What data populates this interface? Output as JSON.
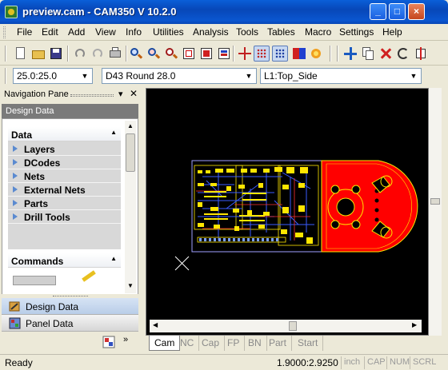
{
  "window": {
    "title": "preview.cam - CAM350 V 10.2.0",
    "controls": [
      "_",
      "□",
      "×"
    ]
  },
  "menu": [
    "File",
    "Edit",
    "Add",
    "View",
    "Info",
    "Utilities",
    "Analysis",
    "Tools",
    "Tables",
    "Macro",
    "Settings",
    "Help"
  ],
  "mdi_controls": [
    "_",
    "□",
    "×"
  ],
  "toolbar": {
    "icons": [
      "new-file-icon",
      "open-folder-icon",
      "save-icon",
      "undo-icon",
      "redo-icon",
      "print-icon",
      "zoom-window-icon",
      "zoom-in-icon",
      "zoom-out-icon",
      "zoom-all-icon",
      "redraw-icon",
      "print-preview-icon",
      "snap-icon",
      "grid-icon",
      "grid-dots-icon",
      "layer-color-icon",
      "highlight-icon",
      "pan-icon",
      "copy-icon",
      "delete-icon",
      "rotate-icon",
      "mirror-icon"
    ]
  },
  "combos": {
    "grid": "25.0:25.0",
    "dcode": "D43  Round 28.0",
    "layer": "L1:Top_Side"
  },
  "nav_pane": {
    "title": "Navigation Pane",
    "section": "Design Data",
    "data_group": {
      "title": "Data",
      "items": [
        "Layers",
        "DCodes",
        "Nets",
        "External Nets",
        "Parts",
        "Drill Tools"
      ]
    },
    "commands_group": {
      "title": "Commands"
    },
    "buttons": [
      "Design Data",
      "Panel Data"
    ]
  },
  "view_tabs": [
    "Cam",
    "NC",
    "Cap",
    "FP",
    "BN",
    "Part",
    "Start"
  ],
  "active_tab": "Cam",
  "status": {
    "ready": "Ready",
    "coords": "1.9000:2.9250",
    "indicators": [
      "inch",
      "CAP",
      "NUM",
      "SCRL"
    ]
  },
  "colors": {
    "canvas": "#000000",
    "pad_red": "#ff0000",
    "outline_yellow": "#ffee00",
    "trace_blue": "#3a5cff",
    "selection_bar": "#7a7a7a"
  }
}
